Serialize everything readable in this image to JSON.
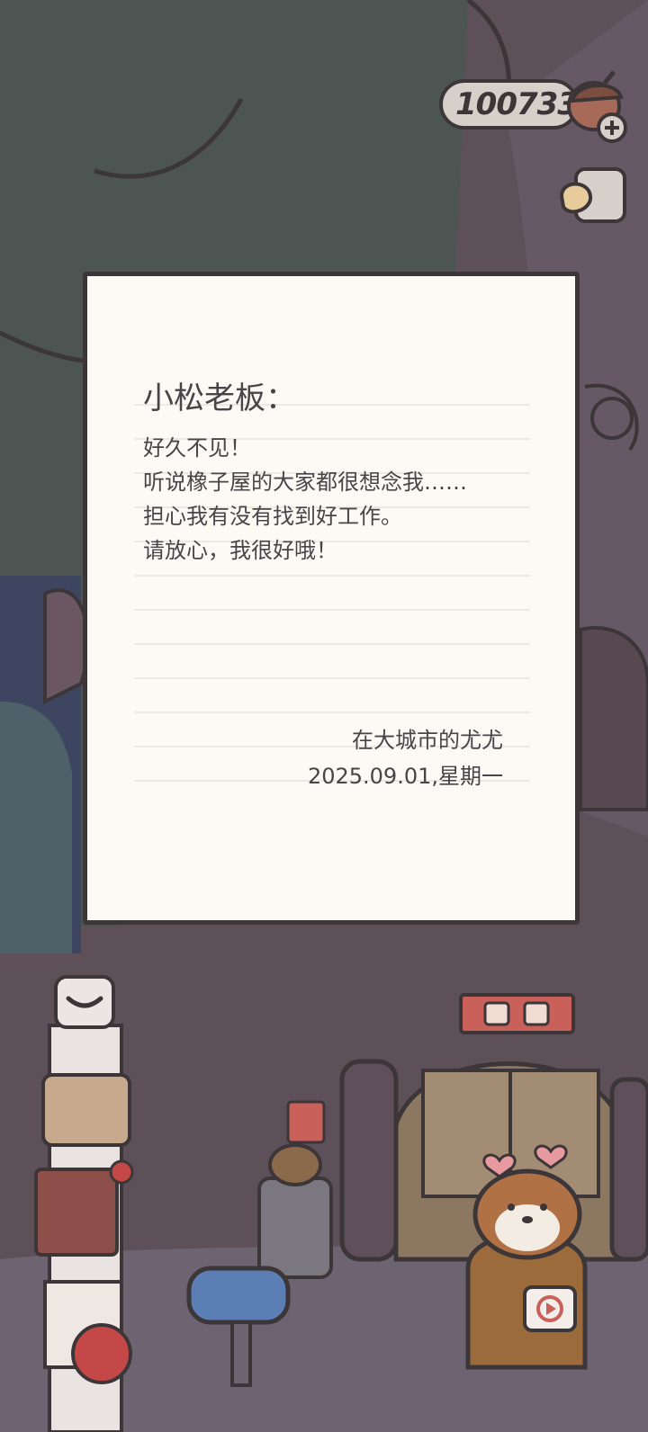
{
  "hud": {
    "acorn_count": "100733",
    "acorn_icon": "acorn-icon",
    "add_icon": "plus-icon",
    "pointer_icon": "pointing-hand-icon"
  },
  "letter": {
    "greeting": "小松老板：",
    "body_lines": [
      "好久不见！",
      "听说橡子屋的大家都很想念我……",
      "担心我有没有找到好工作。",
      "请放心，我很好哦！"
    ],
    "signature": "在大城市的尤尤",
    "date": "2025.09.01,星期一"
  },
  "scene": {
    "icons": [
      "mail-icon",
      "mailbox-icon",
      "shop-sign-icon",
      "video-ad-icon"
    ]
  },
  "colors": {
    "outline": "#3c3638",
    "paper": "#fdfaf6",
    "sky": "#4d5553",
    "trunk": "#5e5059",
    "ground": "#6d6472",
    "red_sign": "#c9605a",
    "mailbox_blue": "#5b7fb5"
  }
}
